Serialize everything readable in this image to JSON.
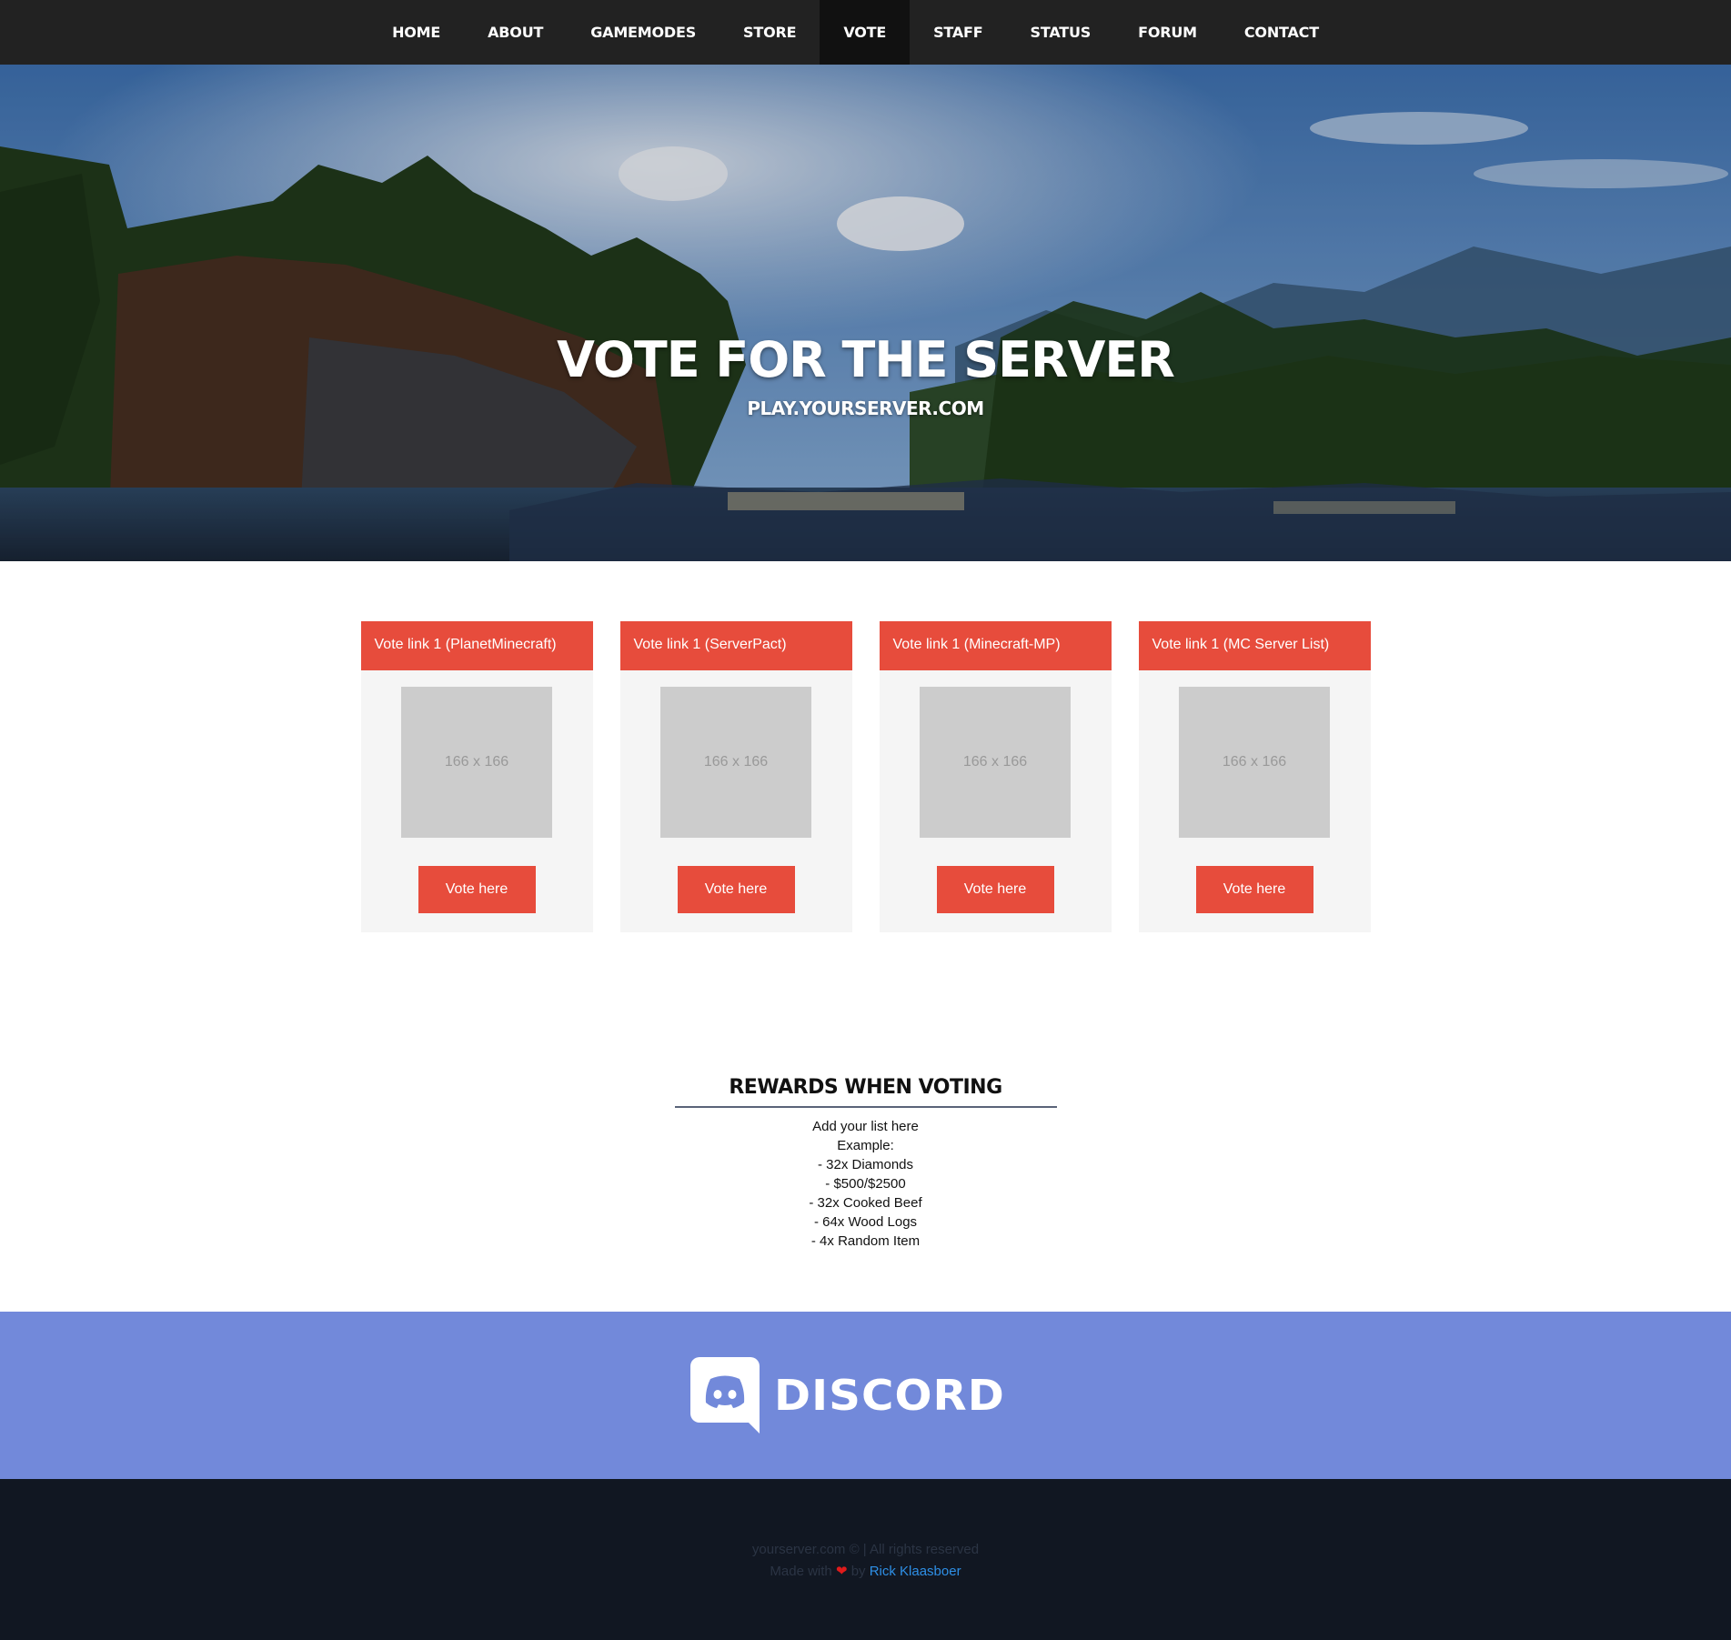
{
  "nav": {
    "items": [
      {
        "label": "HOME"
      },
      {
        "label": "ABOUT"
      },
      {
        "label": "GAMEMODES"
      },
      {
        "label": "STORE"
      },
      {
        "label": "VOTE"
      },
      {
        "label": "STAFF"
      },
      {
        "label": "STATUS"
      },
      {
        "label": "FORUM"
      },
      {
        "label": "CONTACT"
      }
    ],
    "active": "VOTE"
  },
  "hero": {
    "title": "VOTE FOR THE SERVER",
    "subtitle": "PLAY.YOURSERVER.COM"
  },
  "vote_cards": [
    {
      "header": "Vote link 1 (PlanetMinecraft)",
      "placeholder": "166 x 166",
      "button": "Vote here"
    },
    {
      "header": "Vote link 1 (ServerPact)",
      "placeholder": "166 x 166",
      "button": "Vote here"
    },
    {
      "header": "Vote link 1 (Minecraft-MP)",
      "placeholder": "166 x 166",
      "button": "Vote here"
    },
    {
      "header": "Vote link 1 (MC Server List)",
      "placeholder": "166 x 166",
      "button": "Vote here"
    }
  ],
  "rewards": {
    "title": "REWARDS WHEN VOTING",
    "lines": [
      "Add your list here",
      "Example:",
      "- 32x Diamonds",
      "- $500/$2500",
      "- 32x Cooked Beef",
      "- 64x Wood Logs",
      "- 4x Random Item"
    ]
  },
  "discord": {
    "wordmark": "DISCORD"
  },
  "footer": {
    "copyright": "yourserver.com © | All rights reserved",
    "made_with": "Made with",
    "by": "by",
    "author": "Rick Klaasboer"
  },
  "colors": {
    "accent_red": "#e74c3c",
    "nav_bg": "#222222",
    "discord_blurple": "#7289da",
    "footer_bg": "#111722",
    "link_blue": "#2e8fe6"
  }
}
